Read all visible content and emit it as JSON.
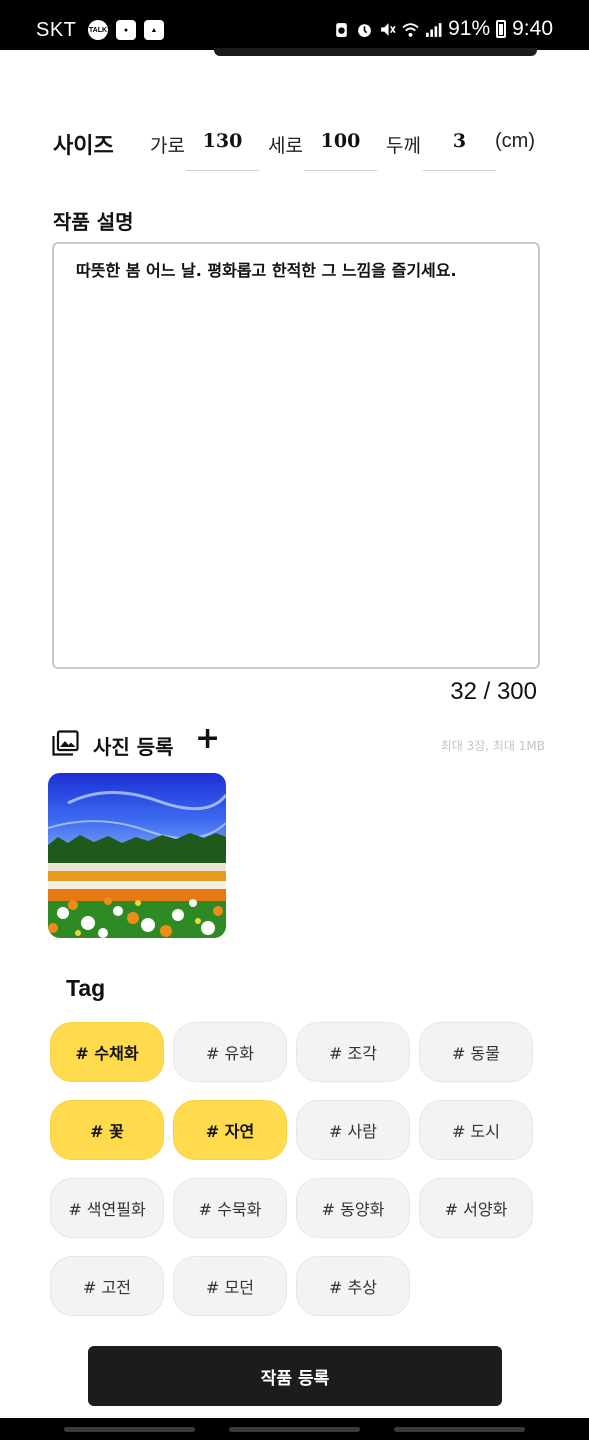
{
  "status_bar": {
    "carrier": "SKT",
    "left_icons": [
      "talk-icon",
      "notification-icon",
      "gallery-icon"
    ],
    "right_icons": [
      "battery-saver-icon",
      "alarm-icon",
      "mute-icon",
      "wifi-icon",
      "signal-icon"
    ],
    "battery_percent": "91%",
    "time": "9:40"
  },
  "size": {
    "title": "사이즈",
    "width_label": "가로",
    "width_value": "130",
    "height_label": "세로",
    "height_value": "100",
    "depth_label": "두께",
    "depth_value": "3",
    "unit": "(cm)"
  },
  "description": {
    "title": "작품 설명",
    "text": "따뜻한 봄 어느 날. 평화롭고 한적한 그 느낌을 즐기세요.",
    "count": "32 / 300"
  },
  "photos": {
    "title": "사진 등록",
    "add_symbol": "+",
    "limit_text": "최대 3장, 최대 1MB",
    "thumbnail_name": "flower-field-photo"
  },
  "tags": {
    "title": "Tag",
    "items": [
      {
        "label": "# 수채화",
        "selected": true
      },
      {
        "label": "# 유화",
        "selected": false
      },
      {
        "label": "# 조각",
        "selected": false
      },
      {
        "label": "# 동물",
        "selected": false
      },
      {
        "label": "# 꽃",
        "selected": true
      },
      {
        "label": "# 자연",
        "selected": true
      },
      {
        "label": "# 사람",
        "selected": false
      },
      {
        "label": "# 도시",
        "selected": false
      },
      {
        "label": "# 색연필화",
        "selected": false
      },
      {
        "label": "# 수묵화",
        "selected": false
      },
      {
        "label": "# 동양화",
        "selected": false
      },
      {
        "label": "# 서양화",
        "selected": false
      },
      {
        "label": "# 고전",
        "selected": false
      },
      {
        "label": "# 모던",
        "selected": false
      },
      {
        "label": "# 추상",
        "selected": false
      }
    ]
  },
  "submit_label": "작품 등록",
  "colors": {
    "selected_tag": "#ffdb4d",
    "tag_bg": "#f3f3f3",
    "button_bg": "#1c1c1e"
  }
}
